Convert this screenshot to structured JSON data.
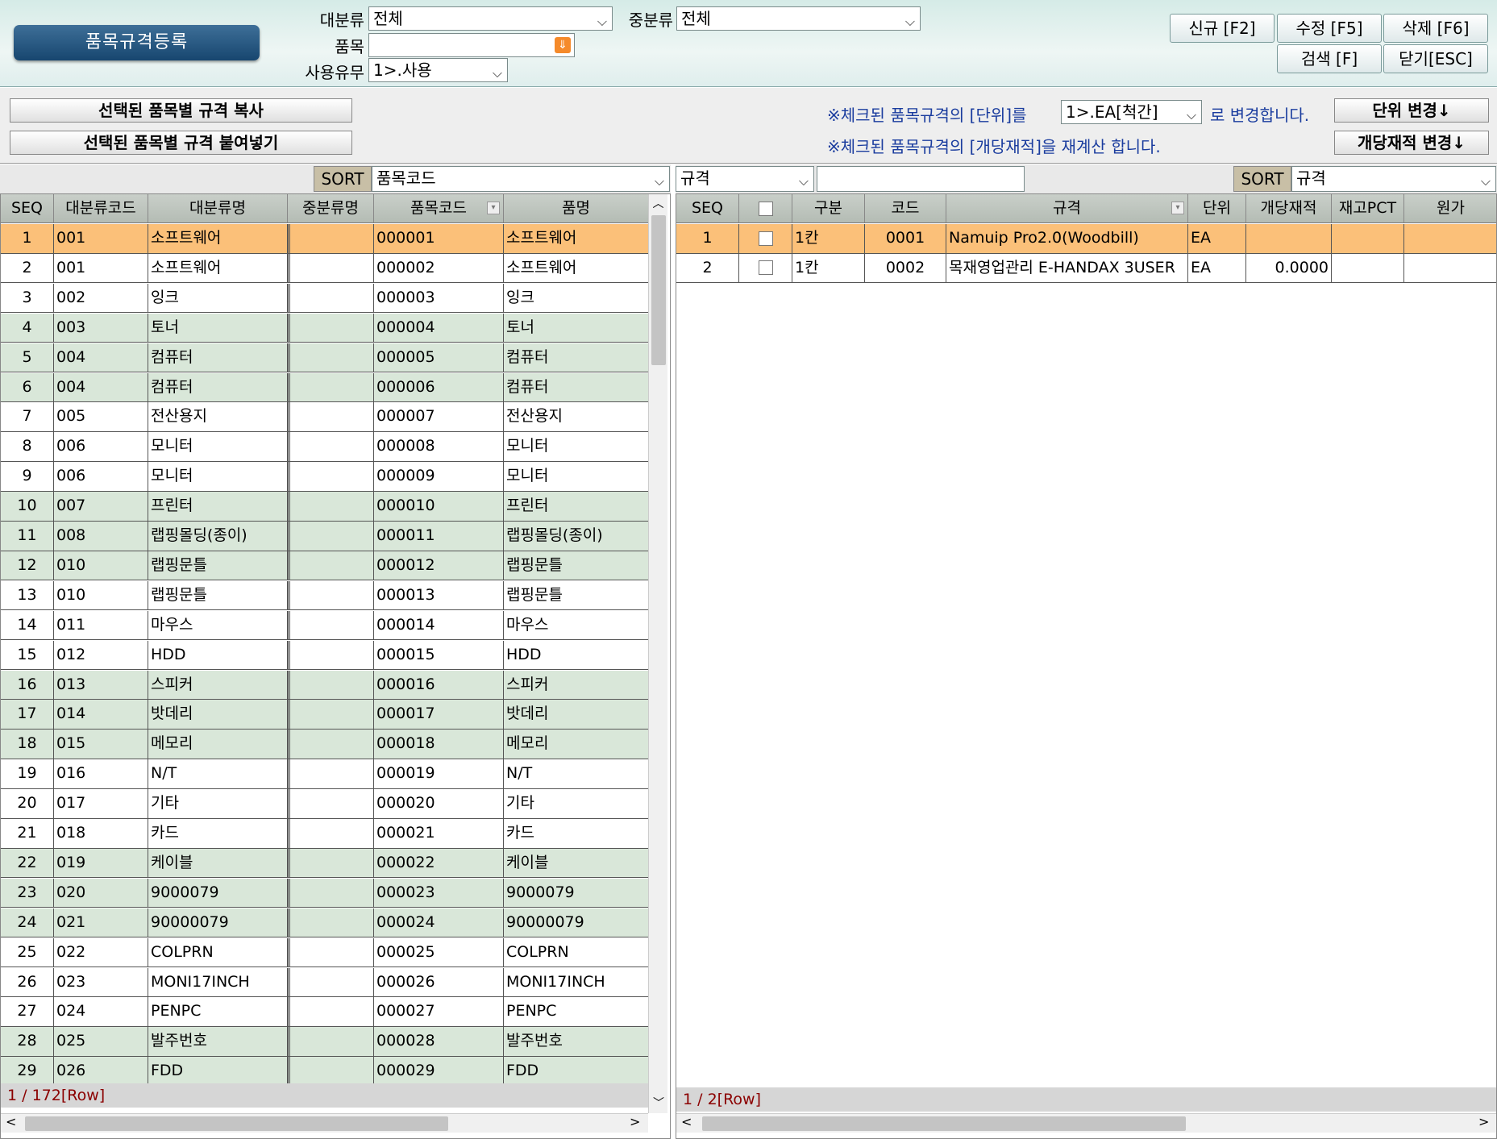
{
  "app": {
    "title": "품목규격등록"
  },
  "filters": {
    "major_label": "대분류",
    "major_value": "전체",
    "mid_label": "중분류",
    "mid_value": "전체",
    "item_label": "품목",
    "item_value": "",
    "use_label": "사용유무",
    "use_value": "1>.사용"
  },
  "toolbar": {
    "new": "신규 [F2]",
    "edit": "수정 [F5]",
    "delete": "삭제 [F6]",
    "search": "검색 [F]",
    "close": "닫기[ESC]"
  },
  "actions": {
    "copy": "선택된 품목별 규격 복사",
    "paste": "선택된 품목별 규격 붙여넣기",
    "unit_note_pre": "※체크된 품목규격의 [단위]를",
    "unit_value": "1>.EA[척간]",
    "unit_note_post": "로 변경합니다.",
    "unit_button": "단위 변경↓",
    "qty_note": "※체크된 품목규격의 [개당재적]을 재계산 합니다.",
    "qty_button": "개당재적 변경↓"
  },
  "left": {
    "sort_label": "SORT",
    "sort_value": "품목코드",
    "columns": [
      "SEQ",
      "대분류코드",
      "대분류명",
      "중분류명",
      "품목코드",
      "품명"
    ],
    "rows": [
      [
        "1",
        "001",
        "소프트웨어",
        "",
        "000001",
        "소프트웨어"
      ],
      [
        "2",
        "001",
        "소프트웨어",
        "",
        "000002",
        "소프트웨어"
      ],
      [
        "3",
        "002",
        "잉크",
        "",
        "000003",
        "잉크"
      ],
      [
        "4",
        "003",
        "토너",
        "",
        "000004",
        "토너"
      ],
      [
        "5",
        "004",
        "컴퓨터",
        "",
        "000005",
        "컴퓨터"
      ],
      [
        "6",
        "004",
        "컴퓨터",
        "",
        "000006",
        "컴퓨터"
      ],
      [
        "7",
        "005",
        "전산용지",
        "",
        "000007",
        "전산용지"
      ],
      [
        "8",
        "006",
        "모니터",
        "",
        "000008",
        "모니터"
      ],
      [
        "9",
        "006",
        "모니터",
        "",
        "000009",
        "모니터"
      ],
      [
        "10",
        "007",
        "프린터",
        "",
        "000010",
        "프린터"
      ],
      [
        "11",
        "008",
        "랩핑몰딩(종이)",
        "",
        "000011",
        "랩핑몰딩(종이)"
      ],
      [
        "12",
        "010",
        "랩핑문틀",
        "",
        "000012",
        "랩핑문틀"
      ],
      [
        "13",
        "010",
        "랩핑문틀",
        "",
        "000013",
        "랩핑문틀"
      ],
      [
        "14",
        "011",
        "마우스",
        "",
        "000014",
        "마우스"
      ],
      [
        "15",
        "012",
        "HDD",
        "",
        "000015",
        "HDD"
      ],
      [
        "16",
        "013",
        "스피커",
        "",
        "000016",
        "스피커"
      ],
      [
        "17",
        "014",
        "밧데리",
        "",
        "000017",
        "밧데리"
      ],
      [
        "18",
        "015",
        "메모리",
        "",
        "000018",
        "메모리"
      ],
      [
        "19",
        "016",
        "N/T",
        "",
        "000019",
        "N/T"
      ],
      [
        "20",
        "017",
        "기타",
        "",
        "000020",
        "기타"
      ],
      [
        "21",
        "018",
        "카드",
        "",
        "000021",
        "카드"
      ],
      [
        "22",
        "019",
        "케이블",
        "",
        "000022",
        "케이블"
      ],
      [
        "23",
        "020",
        "9000079",
        "",
        "000023",
        "9000079"
      ],
      [
        "24",
        "021",
        "90000079",
        "",
        "000024",
        "90000079"
      ],
      [
        "25",
        "022",
        "COLPRN",
        "",
        "000025",
        "COLPRN"
      ],
      [
        "26",
        "023",
        "MONI17INCH",
        "",
        "000026",
        "MONI17INCH"
      ],
      [
        "27",
        "024",
        "PENPC",
        "",
        "000027",
        "PENPC"
      ],
      [
        "28",
        "025",
        "발주번호",
        "",
        "000028",
        "발주번호"
      ],
      [
        "29",
        "026",
        "FDD",
        "",
        "000029",
        "FDD"
      ]
    ],
    "shade": [
      "s",
      "w",
      "w",
      "g",
      "g",
      "g",
      "w",
      "w",
      "w",
      "g",
      "g",
      "g",
      "w",
      "w",
      "w",
      "g",
      "g",
      "g",
      "w",
      "w",
      "w",
      "g",
      "g",
      "g",
      "w",
      "w",
      "w",
      "g",
      "g"
    ],
    "status": "1 / 172[Row]"
  },
  "right": {
    "filter_field": "규격",
    "filter_value": "",
    "sort_label": "SORT",
    "sort_value": "규격",
    "columns": [
      "SEQ",
      "",
      "구분",
      "코드",
      "규격",
      "단위",
      "개당재적",
      "재고PCT",
      "원가"
    ],
    "rows": [
      [
        "1",
        "",
        "1칸",
        "0001",
        "Namuip Pro2.0(Woodbill)",
        "EA",
        "",
        "",
        ""
      ],
      [
        "2",
        "",
        "1칸",
        "0002",
        "목재영업관리 E-HANDAX 3USER",
        "EA",
        "0.0000",
        "",
        ""
      ]
    ],
    "status": "1 / 2[Row]"
  },
  "icons": {
    "dropdown": "chevron-down-icon",
    "item_search": "orange-search-icon",
    "scroll_left": "arrow-left-icon",
    "scroll_right": "arrow-right-icon",
    "scroll_up": "arrow-up-icon",
    "scroll_down": "arrow-down-icon",
    "filter": "filter-icon"
  },
  "colors": {
    "selected_row": "#fbc079",
    "alt_row": "#d9e7d9",
    "title_button": "#1f4f79",
    "note_text": "#1a3c9e"
  }
}
